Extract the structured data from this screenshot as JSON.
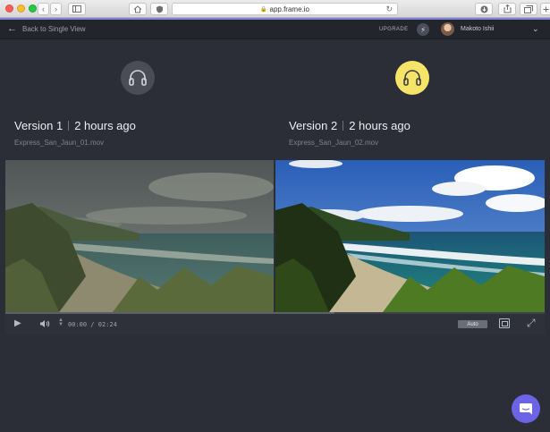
{
  "browser": {
    "url": "app.frame.io",
    "back_glyph": "‹",
    "forward_glyph": "›",
    "icons": [
      "sidebar-icon",
      "home-icon",
      "shield-icon",
      "lock-icon",
      "reload-icon",
      "download-icon",
      "share-icon",
      "tabs-icon",
      "new-tab-icon"
    ]
  },
  "header": {
    "back_label": "Back to Single View",
    "upgrade_label": "UPGRADE",
    "user_name": "Makoto Ishii"
  },
  "versions": [
    {
      "label": "Version 1",
      "time": "2 hours ago",
      "file": "Express_San_Jaun_01.mov",
      "audio_active": false,
      "color": "#4a4d56"
    },
    {
      "label": "Version 2",
      "time": "2 hours ago",
      "file": "Express_San_Jaun_02.mov",
      "audio_active": true,
      "color": "#f5e468"
    }
  ],
  "player": {
    "time_current": "00:00",
    "time_sep": "/",
    "time_total": "02:24",
    "quality": "Auto",
    "buffered_fraction": 0.61
  },
  "colors": {
    "background": "#2b2e37",
    "header": "#23252d",
    "accent": "#7f82d9",
    "chat": "#6c63e6"
  }
}
